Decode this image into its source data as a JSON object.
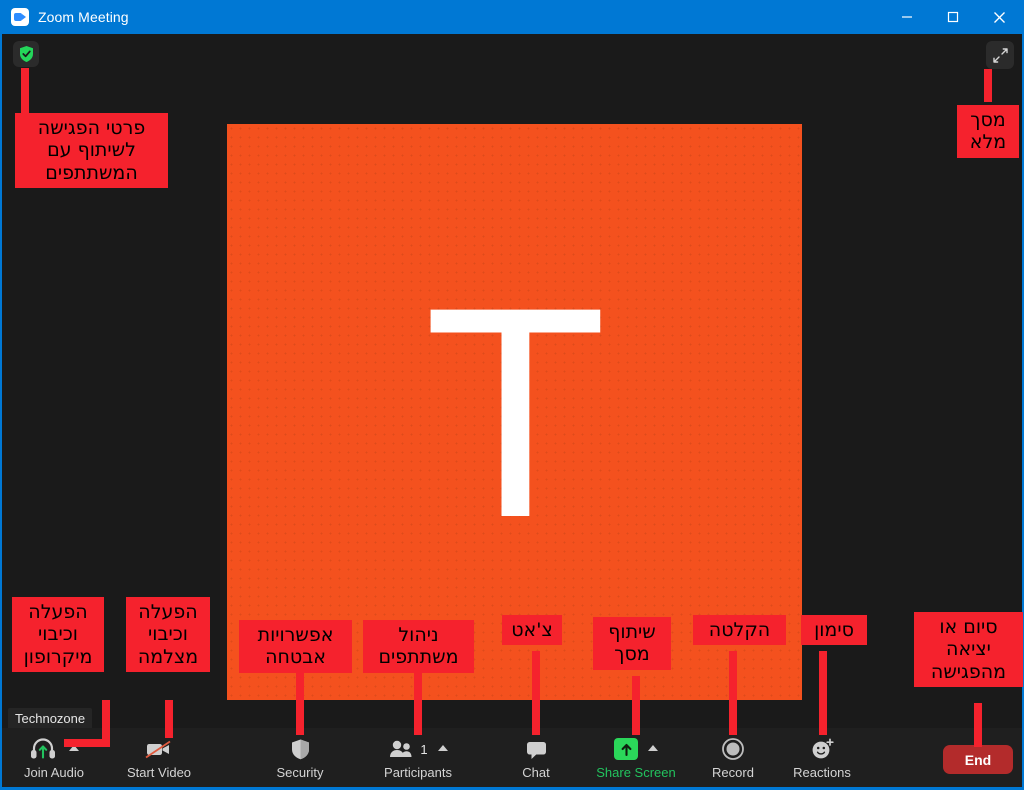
{
  "window": {
    "title": "Zoom Meeting",
    "app_icon": "zoom-camera-icon",
    "minimize_label": "Minimize",
    "maximize_label": "Maximize",
    "close_label": "Close",
    "accent_color": "#0078d4"
  },
  "meeting": {
    "shield_icon": "shield-check-icon",
    "fullscreen_icon": "expand-arrows-icon",
    "tile_initial": "T",
    "participant_name": "Technozone",
    "tile_color": "#f4511e"
  },
  "toolbar": {
    "items": [
      {
        "label": "Join Audio",
        "icon": "headset-join-audio-icon",
        "caret": true,
        "count": "",
        "green": false
      },
      {
        "label": "Start Video",
        "icon": "camera-off-icon",
        "caret": false,
        "count": "",
        "green": false
      },
      {
        "label": "Security",
        "icon": "shield-icon",
        "caret": false,
        "count": "",
        "green": false
      },
      {
        "label": "Participants",
        "icon": "people-icon",
        "caret": true,
        "count": "1",
        "green": false
      },
      {
        "label": "Chat",
        "icon": "chat-bubble-icon",
        "caret": false,
        "count": "",
        "green": false
      },
      {
        "label": "Share Screen",
        "icon": "share-screen-icon",
        "caret": true,
        "count": "",
        "green": true
      },
      {
        "label": "Record",
        "icon": "record-circle-icon",
        "caret": false,
        "count": "",
        "green": false
      },
      {
        "label": "Reactions",
        "icon": "reactions-smiley-icon",
        "caret": false,
        "count": "",
        "green": false
      }
    ],
    "end_label": "End",
    "end_color": "#b32b2b",
    "share_color": "#22c35e"
  },
  "annotations": [
    {
      "id": "meeting-details",
      "text": "פרטי הפגישה לשיתוף עם המשתתפים"
    },
    {
      "id": "full-screen",
      "text": "מסך מלא"
    },
    {
      "id": "microphone",
      "text": "הפעלה וכיבוי מיקרופון"
    },
    {
      "id": "camera",
      "text": "הפעלה וכיבוי מצלמה"
    },
    {
      "id": "security",
      "text": "אפשרויות אבטחה"
    },
    {
      "id": "participants",
      "text": "ניהול משתתפים"
    },
    {
      "id": "chat",
      "text": "צ'אט"
    },
    {
      "id": "share-screen",
      "text": "שיתוף מסך"
    },
    {
      "id": "record",
      "text": "הקלטה"
    },
    {
      "id": "reactions",
      "text": "סימון"
    },
    {
      "id": "end-meeting",
      "text": "סיום או יציאה מהפגישה"
    }
  ],
  "annotation_color": "#f5222d"
}
